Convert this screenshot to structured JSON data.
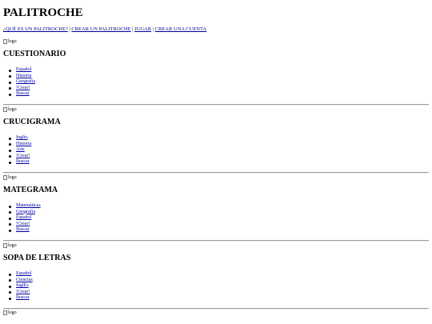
{
  "site": {
    "title": "PALITROCHE",
    "nav": [
      {
        "label": "¿QUÉ ES UN PALITROCHE?"
      },
      {
        "label": "CREAR UN PALITROCHE"
      },
      {
        "label": "JUGAR"
      },
      {
        "label": "CREAR UNA CUENTA"
      }
    ],
    "separator": " | "
  },
  "logo_alt": "logo",
  "sections": [
    {
      "title": "CUESTIONARIO",
      "items": [
        "Español",
        "Historia",
        "Geografía",
        "!Crear!",
        "Buscar"
      ]
    },
    {
      "title": "CRUCIGRAMA",
      "items": [
        "Inglés",
        "Historia",
        "Arte",
        "!Crear!",
        "Buscar"
      ]
    },
    {
      "title": "MATEGRAMA",
      "items": [
        "Matemáticas",
        "Geografía",
        "Español",
        "!Crear!",
        "Buscar"
      ]
    },
    {
      "title": "SOPA DE LETRAS",
      "items": [
        "Español",
        "Ciencias",
        "InglÉs",
        "!Crear!",
        "Buscar"
      ]
    }
  ]
}
